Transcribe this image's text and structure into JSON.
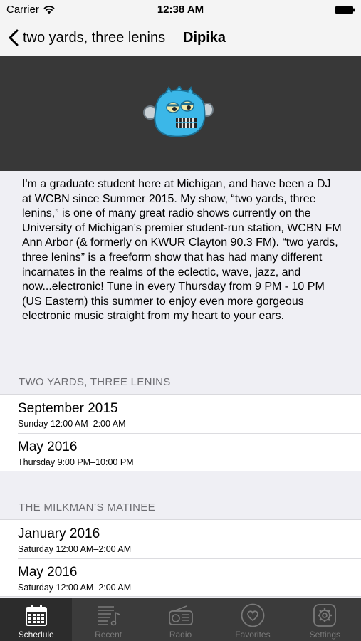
{
  "status": {
    "carrier": "Carrier",
    "time": "12:38 AM"
  },
  "nav": {
    "back_label": "two yards, three lenins",
    "title": "Dipika"
  },
  "bio": "I'm a graduate student here at Michigan, and have been a DJ at WCBN since Summer 2015.  My show, “two yards, three lenins,” is one of many great radio shows currently on the University of Michigan’s premier student-run station, WCBN FM Ann Arbor (& formerly on KWUR Clayton 90.3 FM).  “two yards, three lenins” is a freeform show that has had many different incarnates in the realms of  the eclectic, wave, jazz, and now...electronic!  Tune in every Thursday from 9 PM - 10 PM (US Eastern) this summer to enjoy even more gorgeous electronic music straight from my heart to your ears.",
  "sections": [
    {
      "header": "TWO YARDS, THREE LENINS",
      "rows": [
        {
          "title": "September 2015",
          "subtitle": "Sunday 12:00 AM–2:00 AM"
        },
        {
          "title": "May 2016",
          "subtitle": "Thursday 9:00 PM–10:00 PM"
        }
      ]
    },
    {
      "header": "THE MILKMAN’S MATINEE",
      "rows": [
        {
          "title": "January 2016",
          "subtitle": "Saturday 12:00 AM–2:00 AM"
        },
        {
          "title": "May 2016",
          "subtitle": "Saturday 12:00 AM–2:00 AM"
        }
      ]
    }
  ],
  "tabs": [
    {
      "label": "Schedule",
      "icon": "calendar-icon",
      "active": true
    },
    {
      "label": "Recent",
      "icon": "music-list-icon",
      "active": false
    },
    {
      "label": "Radio",
      "icon": "radio-icon",
      "active": false
    },
    {
      "label": "Favorites",
      "icon": "heart-icon",
      "active": false
    },
    {
      "label": "Settings",
      "icon": "gear-icon",
      "active": false
    }
  ],
  "colors": {
    "hero_bg": "#383838",
    "tab_bar_bg": "#3b3b3b",
    "mascot": "#3bb7e8"
  }
}
